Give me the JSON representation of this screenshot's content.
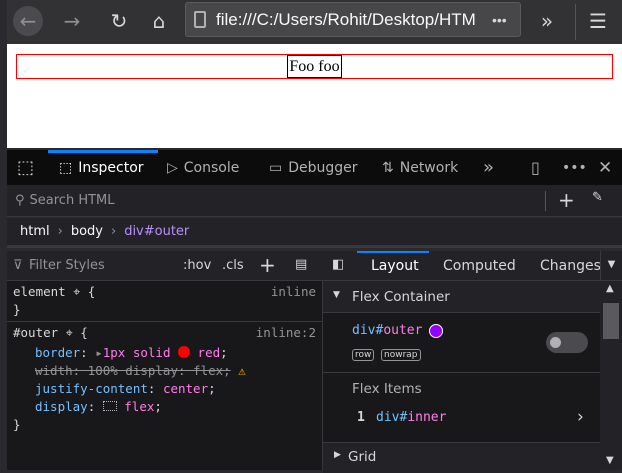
{
  "browser": {
    "url": "file:///C:/Users/Rohit/Desktop/HTM",
    "url_more": "•••"
  },
  "page": {
    "inner_text": "Foo foo"
  },
  "devtools": {
    "tabs": [
      "Inspector",
      "Console",
      "Debugger",
      "Network"
    ],
    "search_placeholder": "Search HTML",
    "breadcrumbs": [
      "html",
      "body",
      "div#outer"
    ],
    "filter_placeholder": "Filter Styles",
    "hov": ":hov",
    "cls": ".cls",
    "side_tabs": [
      "Layout",
      "Computed",
      "Changes"
    ],
    "rules": [
      {
        "selector": "element",
        "source": "inline",
        "open": "{",
        "close": "}"
      },
      {
        "selector": "#outer",
        "source": "inline:2",
        "open": "{",
        "close": "}",
        "decls": [
          {
            "prop": "border",
            "sep": ":",
            "v1": "1px solid",
            "v2": "red",
            "end": ";"
          },
          {
            "text": "width: 100% display: flex;"
          },
          {
            "prop": "justify-content",
            "sep": ":",
            "v1": "center",
            "end": ";"
          },
          {
            "prop": "display",
            "sep": ":",
            "v1": "flex",
            "end": ";"
          }
        ]
      }
    ],
    "layout": {
      "flex_container": "Flex Container",
      "container_el": "div#",
      "container_id": "outer",
      "badges": [
        "row",
        "nowrap"
      ],
      "overlay_color": "#9400ff",
      "flex_items": "Flex Items",
      "item_index": "1",
      "item_el": "div#",
      "item_id": "inner",
      "grid": "Grid"
    }
  }
}
